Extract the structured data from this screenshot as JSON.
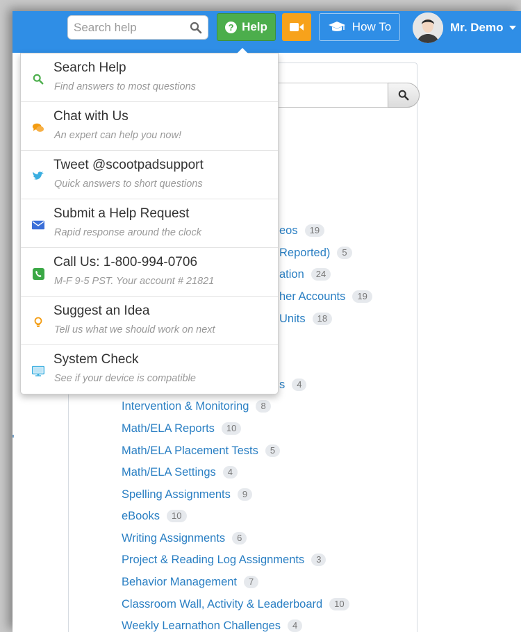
{
  "header": {
    "search_placeholder": "Search help",
    "help_label": "Help",
    "howto_label": "How To",
    "user_name": "Mr. Demo"
  },
  "colors": {
    "topbar": "#2f8ee6",
    "help_button": "#4cae4c",
    "video_button": "#f7a21b",
    "link": "#2a7fc3"
  },
  "help_menu": [
    {
      "icon": "search-icon",
      "title": "Search Help",
      "subtitle": "Find answers to most questions"
    },
    {
      "icon": "chat-icon",
      "title": "Chat with Us",
      "subtitle": "An expert can help you now!"
    },
    {
      "icon": "twitter-icon",
      "title": "Tweet @scootpadsupport",
      "subtitle": "Quick answers to short questions"
    },
    {
      "icon": "envelope-icon",
      "title": "Submit a Help Request",
      "subtitle": "Rapid response around the clock"
    },
    {
      "icon": "phone-icon",
      "title": "Call Us: 1-800-994-0706",
      "subtitle": "M-F 9-5 PST. Your account # 21821"
    },
    {
      "icon": "lightbulb-icon",
      "title": "Suggest an Idea",
      "subtitle": "Tell us what we should work on next"
    },
    {
      "icon": "monitor-icon",
      "title": "System Check",
      "subtitle": "See if your device is compatible"
    }
  ],
  "categories": [
    {
      "label": "eos",
      "count": "19"
    },
    {
      "label": "Reported)",
      "count": "5"
    },
    {
      "label": "ation",
      "count": "24"
    },
    {
      "label": "her Accounts",
      "count": "19"
    },
    {
      "label": "Units",
      "count": "18"
    },
    {
      "label": "s",
      "count": "4"
    },
    {
      "label": "Intervention & Monitoring",
      "count": "8"
    },
    {
      "label": "Math/ELA Reports",
      "count": "10"
    },
    {
      "label": "Math/ELA Placement Tests",
      "count": "5"
    },
    {
      "label": "Math/ELA Settings",
      "count": "4"
    },
    {
      "label": "Spelling Assignments",
      "count": "9"
    },
    {
      "label": "eBooks",
      "count": "10"
    },
    {
      "label": "Writing Assignments",
      "count": "6"
    },
    {
      "label": "Project & Reading Log Assignments",
      "count": "3"
    },
    {
      "label": "Behavior Management",
      "count": "7"
    },
    {
      "label": "Classroom Wall, Activity & Leaderboard",
      "count": "10"
    },
    {
      "label": "Weekly Learnathon Challenges",
      "count": "4"
    }
  ]
}
